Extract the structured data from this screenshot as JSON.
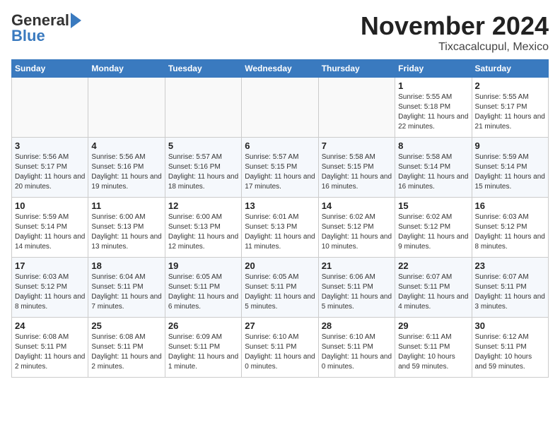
{
  "header": {
    "logo_general": "General",
    "logo_blue": "Blue",
    "month": "November 2024",
    "location": "Tixcacalcupul, Mexico"
  },
  "weekdays": [
    "Sunday",
    "Monday",
    "Tuesday",
    "Wednesday",
    "Thursday",
    "Friday",
    "Saturday"
  ],
  "weeks": [
    [
      {
        "day": "",
        "info": ""
      },
      {
        "day": "",
        "info": ""
      },
      {
        "day": "",
        "info": ""
      },
      {
        "day": "",
        "info": ""
      },
      {
        "day": "",
        "info": ""
      },
      {
        "day": "1",
        "info": "Sunrise: 5:55 AM\nSunset: 5:18 PM\nDaylight: 11 hours and 22 minutes."
      },
      {
        "day": "2",
        "info": "Sunrise: 5:55 AM\nSunset: 5:17 PM\nDaylight: 11 hours and 21 minutes."
      }
    ],
    [
      {
        "day": "3",
        "info": "Sunrise: 5:56 AM\nSunset: 5:17 PM\nDaylight: 11 hours and 20 minutes."
      },
      {
        "day": "4",
        "info": "Sunrise: 5:56 AM\nSunset: 5:16 PM\nDaylight: 11 hours and 19 minutes."
      },
      {
        "day": "5",
        "info": "Sunrise: 5:57 AM\nSunset: 5:16 PM\nDaylight: 11 hours and 18 minutes."
      },
      {
        "day": "6",
        "info": "Sunrise: 5:57 AM\nSunset: 5:15 PM\nDaylight: 11 hours and 17 minutes."
      },
      {
        "day": "7",
        "info": "Sunrise: 5:58 AM\nSunset: 5:15 PM\nDaylight: 11 hours and 16 minutes."
      },
      {
        "day": "8",
        "info": "Sunrise: 5:58 AM\nSunset: 5:14 PM\nDaylight: 11 hours and 16 minutes."
      },
      {
        "day": "9",
        "info": "Sunrise: 5:59 AM\nSunset: 5:14 PM\nDaylight: 11 hours and 15 minutes."
      }
    ],
    [
      {
        "day": "10",
        "info": "Sunrise: 5:59 AM\nSunset: 5:14 PM\nDaylight: 11 hours and 14 minutes."
      },
      {
        "day": "11",
        "info": "Sunrise: 6:00 AM\nSunset: 5:13 PM\nDaylight: 11 hours and 13 minutes."
      },
      {
        "day": "12",
        "info": "Sunrise: 6:00 AM\nSunset: 5:13 PM\nDaylight: 11 hours and 12 minutes."
      },
      {
        "day": "13",
        "info": "Sunrise: 6:01 AM\nSunset: 5:13 PM\nDaylight: 11 hours and 11 minutes."
      },
      {
        "day": "14",
        "info": "Sunrise: 6:02 AM\nSunset: 5:12 PM\nDaylight: 11 hours and 10 minutes."
      },
      {
        "day": "15",
        "info": "Sunrise: 6:02 AM\nSunset: 5:12 PM\nDaylight: 11 hours and 9 minutes."
      },
      {
        "day": "16",
        "info": "Sunrise: 6:03 AM\nSunset: 5:12 PM\nDaylight: 11 hours and 8 minutes."
      }
    ],
    [
      {
        "day": "17",
        "info": "Sunrise: 6:03 AM\nSunset: 5:12 PM\nDaylight: 11 hours and 8 minutes."
      },
      {
        "day": "18",
        "info": "Sunrise: 6:04 AM\nSunset: 5:11 PM\nDaylight: 11 hours and 7 minutes."
      },
      {
        "day": "19",
        "info": "Sunrise: 6:05 AM\nSunset: 5:11 PM\nDaylight: 11 hours and 6 minutes."
      },
      {
        "day": "20",
        "info": "Sunrise: 6:05 AM\nSunset: 5:11 PM\nDaylight: 11 hours and 5 minutes."
      },
      {
        "day": "21",
        "info": "Sunrise: 6:06 AM\nSunset: 5:11 PM\nDaylight: 11 hours and 5 minutes."
      },
      {
        "day": "22",
        "info": "Sunrise: 6:07 AM\nSunset: 5:11 PM\nDaylight: 11 hours and 4 minutes."
      },
      {
        "day": "23",
        "info": "Sunrise: 6:07 AM\nSunset: 5:11 PM\nDaylight: 11 hours and 3 minutes."
      }
    ],
    [
      {
        "day": "24",
        "info": "Sunrise: 6:08 AM\nSunset: 5:11 PM\nDaylight: 11 hours and 2 minutes."
      },
      {
        "day": "25",
        "info": "Sunrise: 6:08 AM\nSunset: 5:11 PM\nDaylight: 11 hours and 2 minutes."
      },
      {
        "day": "26",
        "info": "Sunrise: 6:09 AM\nSunset: 5:11 PM\nDaylight: 11 hours and 1 minute."
      },
      {
        "day": "27",
        "info": "Sunrise: 6:10 AM\nSunset: 5:11 PM\nDaylight: 11 hours and 0 minutes."
      },
      {
        "day": "28",
        "info": "Sunrise: 6:10 AM\nSunset: 5:11 PM\nDaylight: 11 hours and 0 minutes."
      },
      {
        "day": "29",
        "info": "Sunrise: 6:11 AM\nSunset: 5:11 PM\nDaylight: 10 hours and 59 minutes."
      },
      {
        "day": "30",
        "info": "Sunrise: 6:12 AM\nSunset: 5:11 PM\nDaylight: 10 hours and 59 minutes."
      }
    ]
  ]
}
